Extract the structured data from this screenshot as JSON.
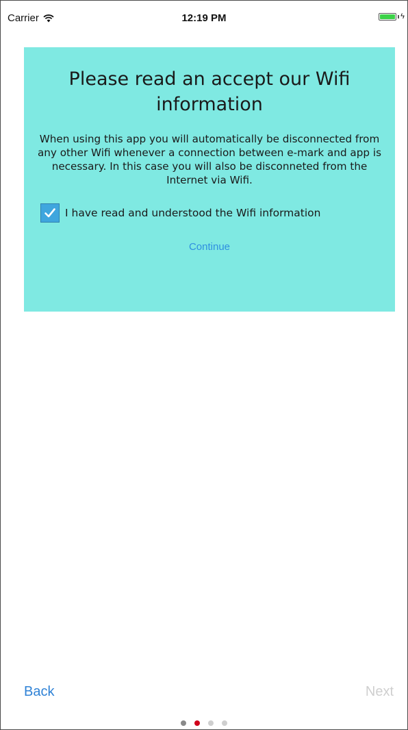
{
  "status_bar": {
    "carrier": "Carrier",
    "time": "12:19 PM",
    "wifi_icon": "wifi-icon",
    "battery_icon": "battery-charging-icon",
    "battery_level": 1.0
  },
  "card": {
    "background_color": "#7fe9e2",
    "title": "Please read an accept our Wifi information",
    "body": "When using this app you will automatically be disconnected from any other Wifi whenever a connection between e-mark and app is necessary. In this case you will also be disconneted from the Internet via Wifi.",
    "checkbox": {
      "checked": true,
      "label": "I have read and understood the Wifi information",
      "icon": "checkmark-icon",
      "color": "#3fa6de"
    },
    "continue_label": "Continue"
  },
  "navigation": {
    "back_label": "Back",
    "next_label": "Next",
    "back_color": "#2f82d6",
    "next_color": "#cfcfcf"
  },
  "pager": {
    "total": 4,
    "current_index": 1,
    "active_color": "#d0021b"
  }
}
